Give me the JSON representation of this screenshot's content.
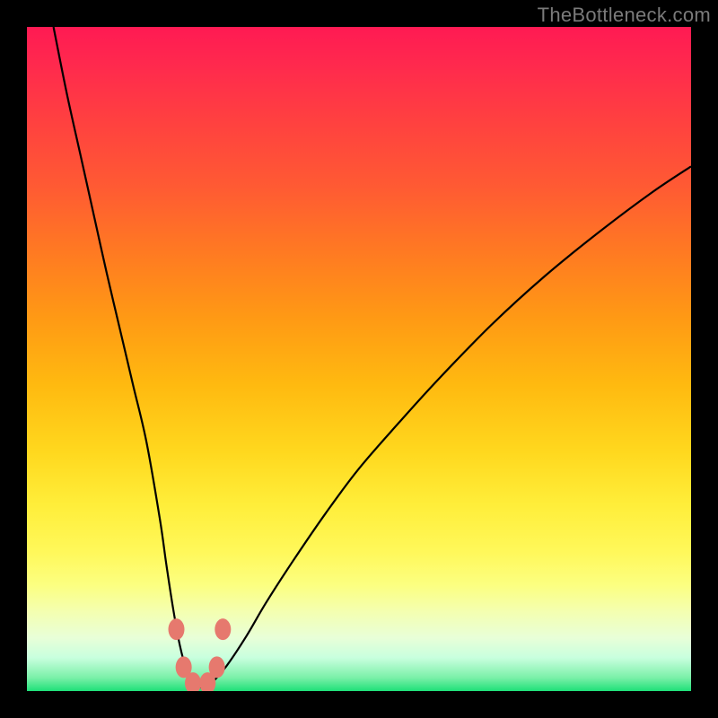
{
  "watermark": "TheBottleneck.com",
  "chart_data": {
    "type": "line",
    "title": "",
    "xlabel": "",
    "ylabel": "",
    "xlim": [
      0,
      100
    ],
    "ylim": [
      0,
      100
    ],
    "grid": false,
    "series": [
      {
        "name": "curve",
        "x": [
          4,
          6,
          8,
          10,
          12,
          14,
          16,
          18,
          20,
          21,
          22,
          23,
          24,
          25,
          26,
          27,
          28,
          30,
          33,
          36,
          40,
          45,
          50,
          56,
          62,
          70,
          78,
          86,
          94,
          100
        ],
        "values": [
          100,
          90,
          81,
          72,
          63,
          54.5,
          46,
          37.5,
          26,
          19,
          12.5,
          7,
          3.3,
          1.4,
          0.6,
          0.6,
          1.4,
          3.7,
          8.2,
          13.3,
          19.5,
          26.8,
          33.5,
          40.4,
          47,
          55.2,
          62.5,
          69,
          75,
          79
        ]
      }
    ],
    "markers": [
      {
        "x": 22.5,
        "y": 9.3
      },
      {
        "x": 23.6,
        "y": 3.6
      },
      {
        "x": 25.0,
        "y": 1.2
      },
      {
        "x": 27.2,
        "y": 1.2
      },
      {
        "x": 28.6,
        "y": 3.6
      },
      {
        "x": 29.5,
        "y": 9.3
      }
    ]
  }
}
